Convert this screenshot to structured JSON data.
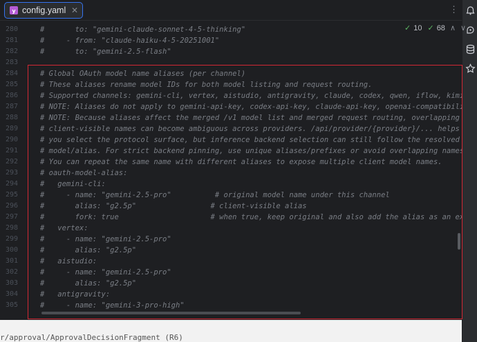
{
  "tab": {
    "label": "config.yaml",
    "icon": "yaml-file-icon"
  },
  "inspections": {
    "warnings": "10",
    "checks": "68"
  },
  "lines": [
    {
      "n": "280",
      "text": "#       to: \"gemini-claude-sonnet-4-5-thinking\""
    },
    {
      "n": "281",
      "text": "#     - from: \"claude-haiku-4-5-20251001\""
    },
    {
      "n": "282",
      "text": "#       to: \"gemini-2.5-flash\""
    },
    {
      "n": "283",
      "text": ""
    },
    {
      "n": "284",
      "text": "# Global OAuth model name aliases (per channel)"
    },
    {
      "n": "285",
      "text": "# These aliases rename model IDs for both model listing and request routing."
    },
    {
      "n": "286",
      "text": "# Supported channels: gemini-cli, vertex, aistudio, antigravity, claude, codex, qwen, iflow, kimi."
    },
    {
      "n": "287",
      "text": "# NOTE: Aliases do not apply to gemini-api-key, codex-api-key, claude-api-key, openai-compatibility, ver"
    },
    {
      "n": "288",
      "text": "# NOTE: Because aliases affect the merged /v1 model list and merged request routing, overlapping"
    },
    {
      "n": "289",
      "text": "# client-visible names can become ambiguous across providers. /api/provider/{provider}/... helps"
    },
    {
      "n": "290",
      "text": "# you select the protocol surface, but inference backend selection can still follow the resolved"
    },
    {
      "n": "291",
      "text": "# model/alias. For strict backend pinning, use unique aliases/prefixes or avoid overlapping names."
    },
    {
      "n": "292",
      "text": "# You can repeat the same name with different aliases to expose multiple client model names."
    },
    {
      "n": "293",
      "text": "# oauth-model-alias:"
    },
    {
      "n": "294",
      "text": "#   gemini-cli:"
    },
    {
      "n": "295",
      "text": "#     - name: \"gemini-2.5-pro\"          # original model name under this channel"
    },
    {
      "n": "296",
      "text": "#       alias: \"g2.5p\"                 # client-visible alias"
    },
    {
      "n": "297",
      "text": "#       fork: true                     # when true, keep original and also add the alias as an extra mo"
    },
    {
      "n": "298",
      "text": "#   vertex:"
    },
    {
      "n": "299",
      "text": "#     - name: \"gemini-2.5-pro\""
    },
    {
      "n": "300",
      "text": "#       alias: \"g2.5p\""
    },
    {
      "n": "301",
      "text": "#   aistudio:"
    },
    {
      "n": "302",
      "text": "#     - name: \"gemini-2.5-pro\""
    },
    {
      "n": "303",
      "text": "#       alias: \"g2.5p\""
    },
    {
      "n": "304",
      "text": "#   antigravity:"
    },
    {
      "n": "305",
      "text": "#     - name: \"gemini-3-pro-high\""
    }
  ],
  "bottom_text": "r/approval/ApprovalDecisionFragment (R6)",
  "right_icons": [
    "notifications-icon",
    "ai-assistant-icon",
    "database-icon",
    "plugin-icon"
  ],
  "colors": {
    "comment": "#7a7e85",
    "accent": "#3574f0",
    "highlight": "#d22834",
    "check": "#5fb865"
  }
}
